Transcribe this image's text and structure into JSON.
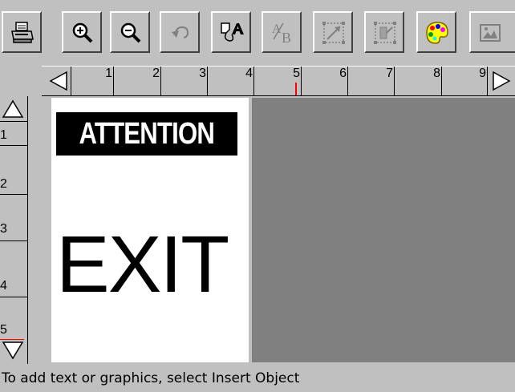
{
  "toolbar": {
    "buttons": [
      {
        "name": "print-button",
        "icon": "printer-icon",
        "enabled": true
      },
      {
        "name": "zoom-in-button",
        "icon": "zoom-in-icon",
        "enabled": true
      },
      {
        "name": "zoom-out-button",
        "icon": "zoom-out-icon",
        "enabled": true
      },
      {
        "name": "undo-button",
        "icon": "undo-icon",
        "enabled": false
      },
      {
        "name": "text-properties-button",
        "icon": "text-properties-icon",
        "enabled": true
      },
      {
        "name": "text-format-button",
        "icon": "text-format-icon",
        "enabled": false
      },
      {
        "name": "resize-object-button",
        "icon": "resize-object-icon",
        "enabled": false
      },
      {
        "name": "align-object-button",
        "icon": "align-object-icon",
        "enabled": false
      },
      {
        "name": "color-palette-button",
        "icon": "palette-icon",
        "enabled": true
      },
      {
        "name": "insert-picture-button",
        "icon": "picture-icon",
        "enabled": false
      }
    ]
  },
  "ruler": {
    "horizontal_numbers": [
      "1",
      "2",
      "3",
      "4",
      "5",
      "6",
      "7",
      "8",
      "9"
    ],
    "vertical_numbers": [
      "1",
      "2",
      "3",
      "4",
      "5"
    ],
    "scroll_left_icon": "triangle-left-icon",
    "scroll_right_icon": "triangle-right-icon",
    "scroll_up_icon": "triangle-up-icon",
    "scroll_down_icon": "triangle-down-icon",
    "cursor_marker_color": "#ff0000"
  },
  "label": {
    "header_text": "ATTENTION",
    "body_text": "EXIT"
  },
  "status_bar": {
    "message": "To add text or graphics, select Insert Object"
  },
  "colors": {
    "chrome": "#c0c0c0",
    "workspace": "#808080",
    "label_background": "#ffffff",
    "header_band": "#000000"
  }
}
